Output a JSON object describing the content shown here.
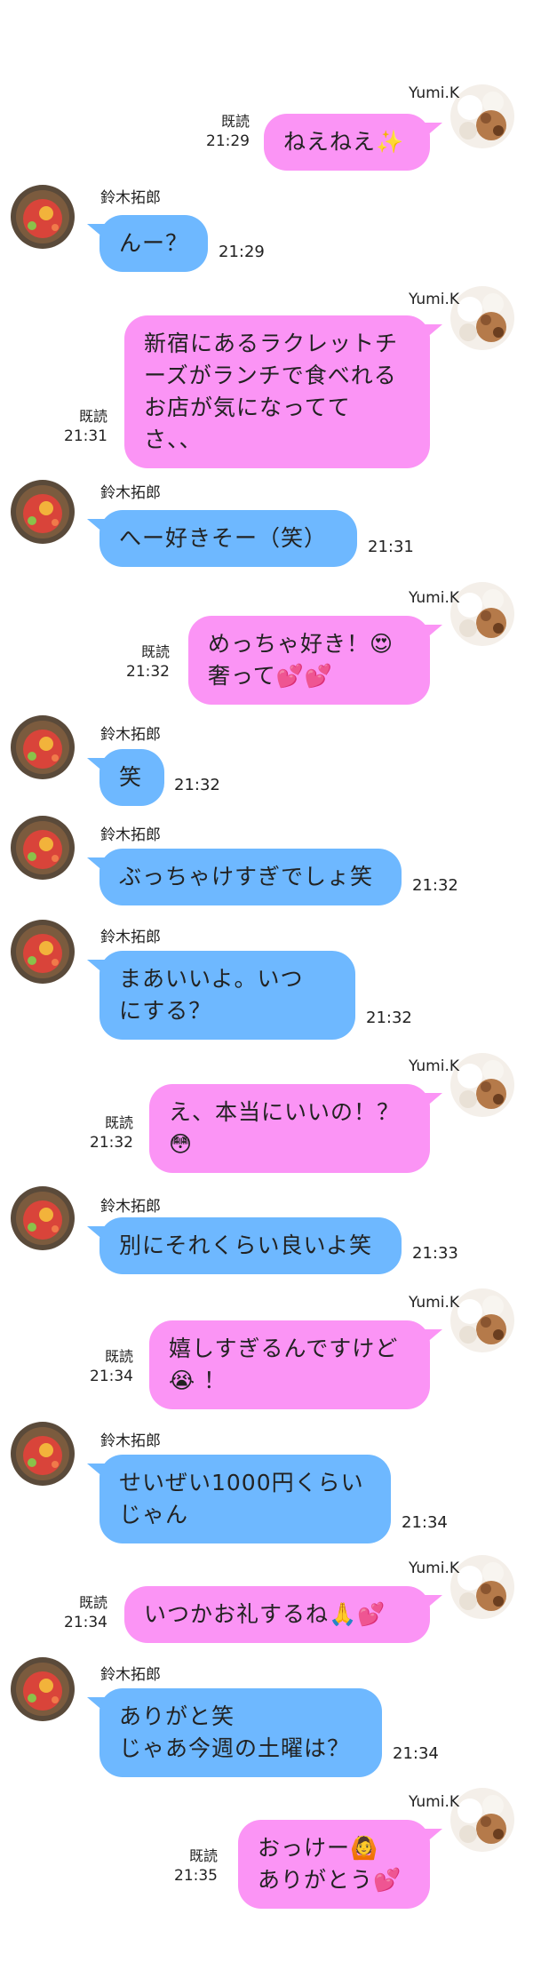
{
  "me_name": "Yumi.K",
  "you_name": "鈴木拓郎",
  "read_label": "既読",
  "colors": {
    "me_bubble": "#fb94f5",
    "you_bubble": "#6eb8ff"
  },
  "messages": [
    {
      "from": "me",
      "lines": [
        "ねえねえ✨"
      ],
      "time": "21:29",
      "read": true
    },
    {
      "from": "you",
      "lines": [
        "んー？"
      ],
      "time": "21:29"
    },
    {
      "from": "me",
      "lines": [
        "新宿にあるラクレットチ",
        "ーズがランチで食べれる",
        "お店が気になってて",
        "さ、、"
      ],
      "time": "21:31",
      "read": true
    },
    {
      "from": "you",
      "lines": [
        "へー好きそー（笑）"
      ],
      "time": "21:31"
    },
    {
      "from": "me",
      "lines": [
        "めっちゃ好き！😍",
        "奢って💕💕"
      ],
      "time": "21:32",
      "read": true
    },
    {
      "from": "you",
      "lines": [
        "笑"
      ],
      "time": "21:32"
    },
    {
      "from": "you",
      "lines": [
        "ぶっちゃけすぎでしょ笑"
      ],
      "time": "21:32"
    },
    {
      "from": "you",
      "lines": [
        "まあいいよ。いつ",
        "にする？"
      ],
      "time": "21:32"
    },
    {
      "from": "me",
      "lines": [
        "え、本当にいいの！？",
        "😳"
      ],
      "time": "21:32",
      "read": true
    },
    {
      "from": "you",
      "lines": [
        "別にそれくらい良いよ笑"
      ],
      "time": "21:33"
    },
    {
      "from": "me",
      "lines": [
        "嬉しすぎるんですけど",
        "😭 ！"
      ],
      "time": "21:34",
      "read": true
    },
    {
      "from": "you",
      "lines": [
        "せいぜい1000円くらい",
        "じゃん"
      ],
      "time": "21:34"
    },
    {
      "from": "me",
      "lines": [
        "いつかお礼するね🙏💕"
      ],
      "time": "21:34",
      "read": true
    },
    {
      "from": "you",
      "lines": [
        "ありがと笑",
        "じゃあ今週の土曜は？"
      ],
      "time": "21:34"
    },
    {
      "from": "me",
      "lines": [
        "おっけー🙆",
        "ありがとう💕"
      ],
      "time": "21:35",
      "read": true
    }
  ]
}
